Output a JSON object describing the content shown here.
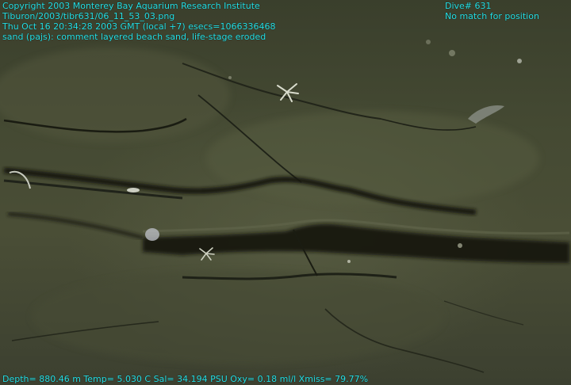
{
  "overlay": {
    "copyright": "Copyright 2003 Monterey Bay Aquarium Research Institute",
    "file_path": "Tiburon/2003/tibr631/06_11_53_03.png",
    "timestamp": "Thu Oct 16 20:34:28 2003 GMT (local +7)  esecs=1066336468",
    "annotation": "sand (pajs): comment layered beach sand, life-stage eroded",
    "dive": "Dive# 631",
    "position_status": "No match for position",
    "telemetry": "Depth= 880.46 m  Temp= 5.030 C  Sal= 34.194 PSU  Oxy= 0.18 ml/l  Xmiss= 79.77%"
  },
  "colors": {
    "overlay_text": "#26e0e6",
    "seafloor": "#454a33",
    "ledge_shadow": "#14160f"
  }
}
